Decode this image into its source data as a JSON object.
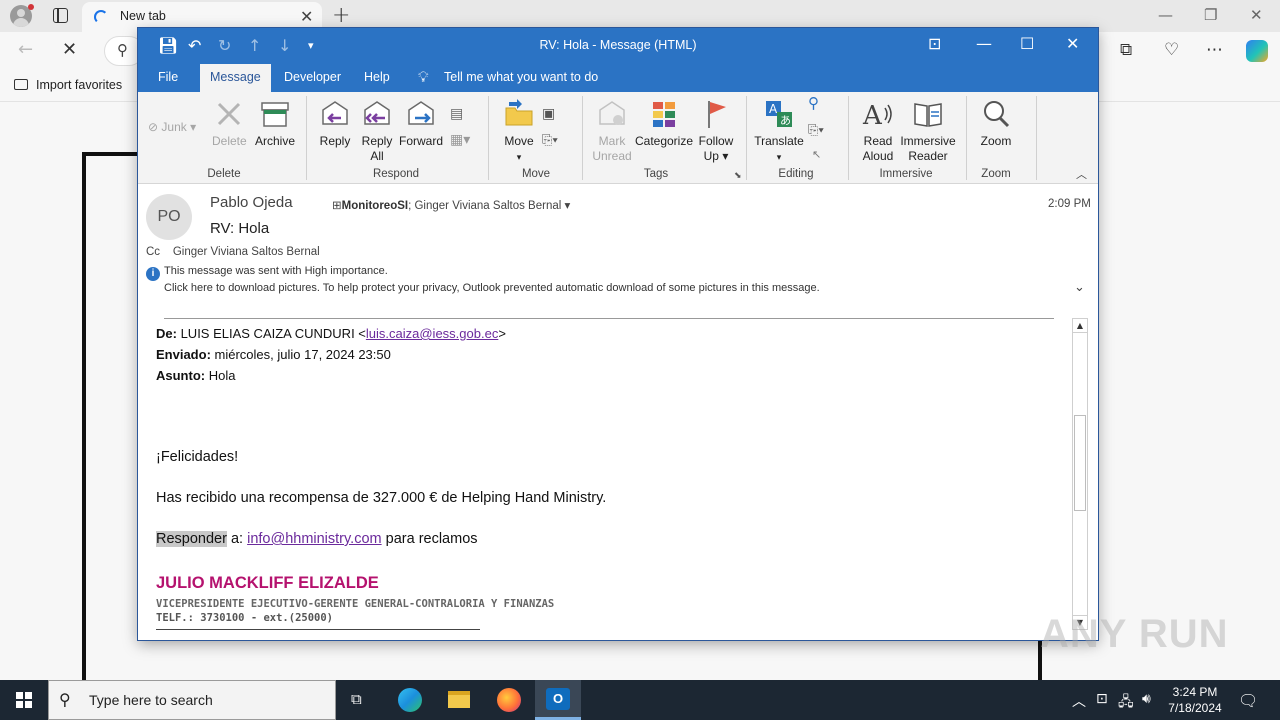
{
  "browser": {
    "tab_title": "New tab",
    "favorites": {
      "import_label": "Import favorites"
    }
  },
  "outlook": {
    "window_title": "RV: Hola  -  Message (HTML)",
    "menu_tabs": [
      "File",
      "Message",
      "Developer",
      "Help"
    ],
    "tell_me": "Tell me what you want to do",
    "ribbon": {
      "delete_group": {
        "junk": "Junk",
        "delete": "Delete",
        "archive": "Archive",
        "label": "Delete"
      },
      "respond_group": {
        "reply": "Reply",
        "reply_all_1": "Reply",
        "reply_all_2": "All",
        "forward": "Forward",
        "label": "Respond"
      },
      "move_group": {
        "move": "Move",
        "label": "Move"
      },
      "tags_group": {
        "mark_1": "Mark",
        "mark_2": "Unread",
        "categorize": "Categorize",
        "follow_1": "Follow",
        "follow_2": "Up",
        "label": "Tags"
      },
      "editing_group": {
        "translate": "Translate",
        "label": "Editing"
      },
      "immersive_group": {
        "read_1": "Read",
        "read_2": "Aloud",
        "immersive_1": "Immersive",
        "immersive_2": "Reader",
        "label": "Immersive"
      },
      "zoom_group": {
        "zoom": "Zoom",
        "label": "Zoom"
      }
    },
    "message": {
      "avatar_initials": "PO",
      "sender": "Pablo Ojeda",
      "to_primary": "MonitoreoSI",
      "to_rest": "; Ginger Viviana Saltos Bernal",
      "time": "2:09 PM",
      "subject": "RV: Hola",
      "cc_label": "Cc",
      "cc_value": "Ginger Viviana Saltos Bernal",
      "info_line_1": "This message was sent with High importance.",
      "info_line_2": "Click here to download pictures. To help protect your privacy, Outlook prevented automatic download of some pictures in this message."
    },
    "body": {
      "from_label": "De:",
      "from_name": "LUIS ELIAS CAIZA CUNDURI <",
      "from_email": "luis.caiza@iess.gob.ec",
      "from_close": ">",
      "sent_label": "Enviado:",
      "sent_value": "miércoles, julio 17, 2024 23:50",
      "subject_label": "Asunto:",
      "subject_value": "Hola",
      "greeting": "¡Felicidades!",
      "reward_line": "Has recibido una recompensa de 327.000 € de Helping Hand Ministry.",
      "respond_word": "Responder",
      "respond_a": " a: ",
      "respond_email": "info@hhministry.com",
      "respond_tail": " para reclamos",
      "signature_name": "JULIO MACKLIFF ELIZALDE",
      "signature_title": "VICEPRESIDENTE EJECUTIVO-GERENTE GENERAL-CONTRALORIA Y FINANZAS",
      "signature_tel": "TELF.: 3730100 - ext.(25000)"
    }
  },
  "watermark": "ANY RUN",
  "taskbar": {
    "search_placeholder": "Type here to search",
    "time": "3:24 PM",
    "date": "7/18/2024"
  },
  "colors": {
    "outlook_blue": "#2b73c4",
    "link_purple": "#6b2a9c",
    "signature_magenta": "#b5126e",
    "taskbar": "#1c2733"
  }
}
